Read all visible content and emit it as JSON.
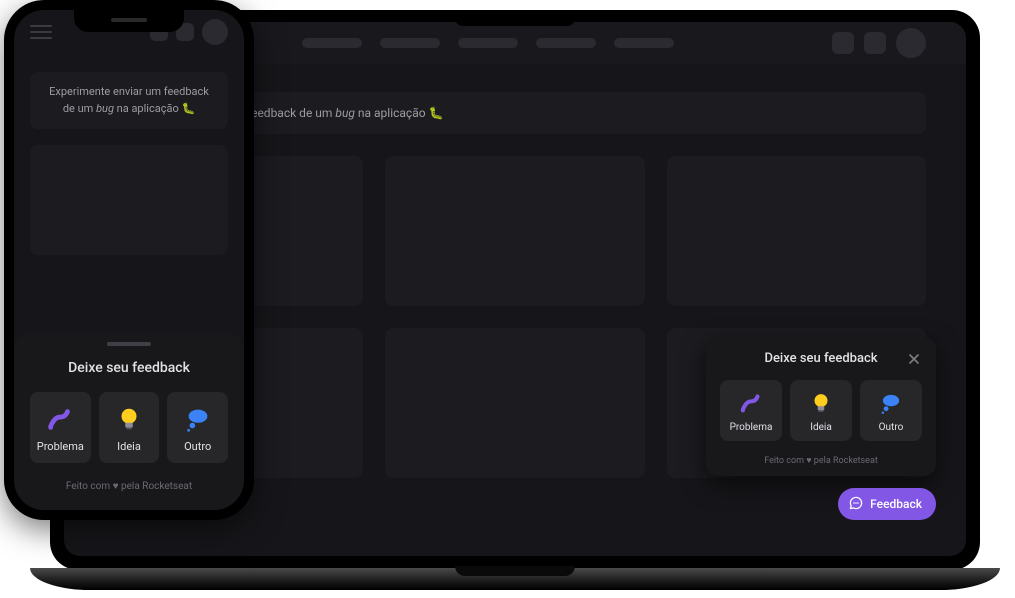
{
  "colors": {
    "accent": "#8257e5",
    "bg": "#16161a",
    "surface": "#18181b",
    "card": "#1b1b20",
    "option": "#27272a",
    "text": "#e1e1e6",
    "muted": "#9c9ca3"
  },
  "banner": {
    "text_before": "Experimente enviar um feedback de um ",
    "text_italic": "bug",
    "text_after": " na aplicação 🐛"
  },
  "feedback": {
    "title": "Deixe seu feedback",
    "options": [
      {
        "id": "problema",
        "label": "Problema",
        "icon": "bug"
      },
      {
        "id": "ideia",
        "label": "Ideia",
        "icon": "lightbulb"
      },
      {
        "id": "outro",
        "label": "Outro",
        "icon": "thought"
      }
    ],
    "footer_before": "Feito com ",
    "footer_heart": "♥",
    "footer_after": " pela Rocketseat"
  },
  "fab": {
    "label": "Feedback"
  }
}
